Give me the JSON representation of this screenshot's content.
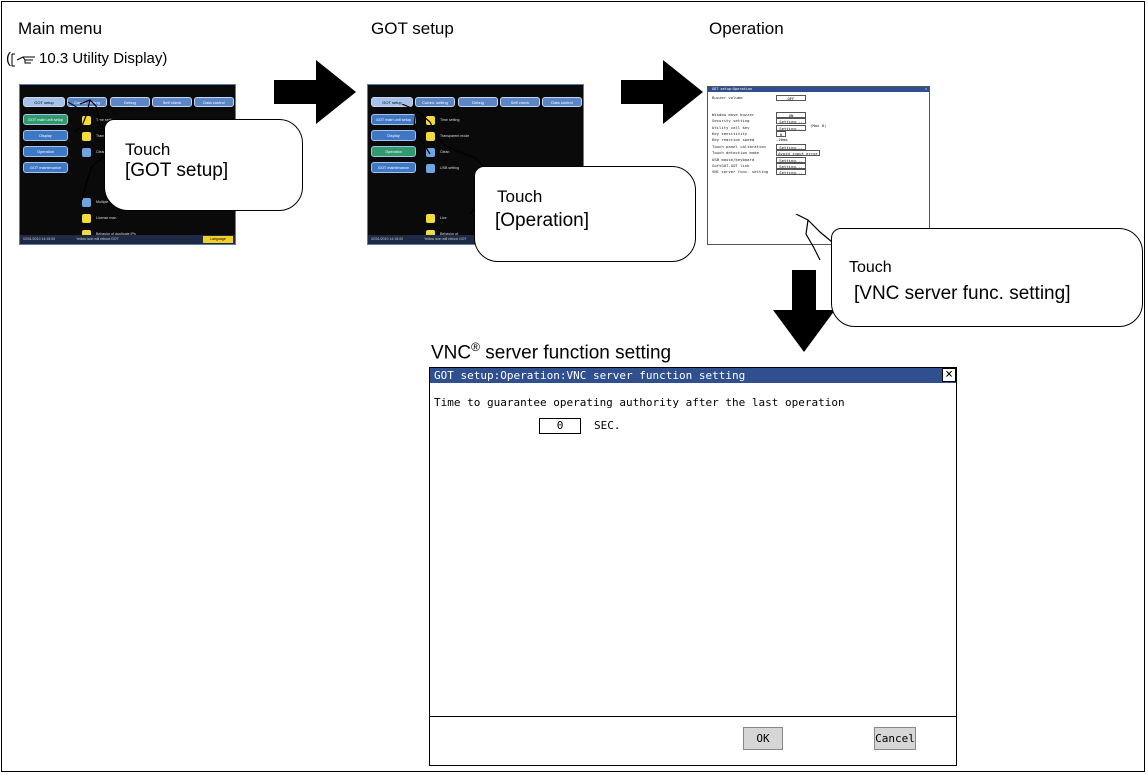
{
  "labels": {
    "main_menu": "Main menu",
    "ref_text": "10.3 Utility Display)",
    "got_setup": "GOT setup",
    "operation": "Operation",
    "vnc_heading": "VNC",
    "vnc_reg": "®",
    "vnc_heading_rest": " server function setting"
  },
  "callouts": [
    {
      "touch": "Touch",
      "target": "[GOT setup]"
    },
    {
      "touch": "Touch",
      "target": "[Operation]"
    },
    {
      "touch": "Touch",
      "target": "[VNC server func. setting]"
    }
  ],
  "thumb_main": {
    "tabs": [
      "GOT setup",
      "Comm. setting",
      "Debug",
      "Self check",
      "Data control"
    ],
    "side": [
      "GOT main unit setup",
      "Display",
      "Operation",
      "GOT maintenance"
    ],
    "items": [
      "Time setting",
      "Transparent mode",
      "Clean",
      "Multiple",
      "License man",
      "Behavior of duplicate IPs"
    ],
    "status_time": "02/01/2010 14:15:00",
    "status_msg": "Yellow icon will reboot GOT",
    "language": "Language"
  },
  "thumb_setup": {
    "tabs": [
      "GOT setup",
      "Comm. setting",
      "Debug",
      "Self check",
      "Data control"
    ],
    "side": [
      "GOT main unit setup",
      "Display",
      "Operation",
      "GOT maintenance"
    ],
    "items": [
      "Time setting",
      "Transparent mode",
      "Clean",
      "USB setting",
      "Lice",
      "Behavior of"
    ],
    "status_time": "02/01/2010 14:15:00",
    "status_msg": "Yellow icon will reboot GOT"
  },
  "thumb_operation": {
    "title": "GOT setup:Operation",
    "rows": [
      {
        "label": "Buzzer volume",
        "value": "OFF"
      },
      {
        "label": "Window move buzzer",
        "value": "ON"
      },
      {
        "label": "Security setting",
        "value": "Setting..."
      },
      {
        "label": "Utility call key",
        "value": "Setting..."
      },
      {
        "label": "Key sensitivity",
        "value": "0"
      },
      {
        "label": "Key reaction speed",
        "value": "-20ms"
      },
      {
        "label": "Touch panel calibration",
        "value": "Setting..."
      },
      {
        "label": "Touch detection mode",
        "value": "Avoid input error"
      },
      {
        "label": "USB mouse/keyboard",
        "value": "Setting..."
      },
      {
        "label": "SoftGOT-GOT link",
        "value": "Setting..."
      },
      {
        "label": "VNC server func. setting",
        "value": "Setting..."
      }
    ],
    "max_note": "(Max 8)",
    "ok": "OK"
  },
  "vnc_window": {
    "title": "GOT setup:Operation:VNC server function setting",
    "close": "×",
    "description": "Time to guarantee operating authority after the last operation",
    "value": "0",
    "unit": "SEC.",
    "ok": "OK",
    "cancel": "Cancel"
  },
  "colors": {
    "title_bar": "#2f4f8f",
    "tab": "#5b86c6",
    "tab_selected": "#a6c2ea",
    "button_gray": "#d6d6d6",
    "icon_yellow": "#f0dc3a"
  }
}
